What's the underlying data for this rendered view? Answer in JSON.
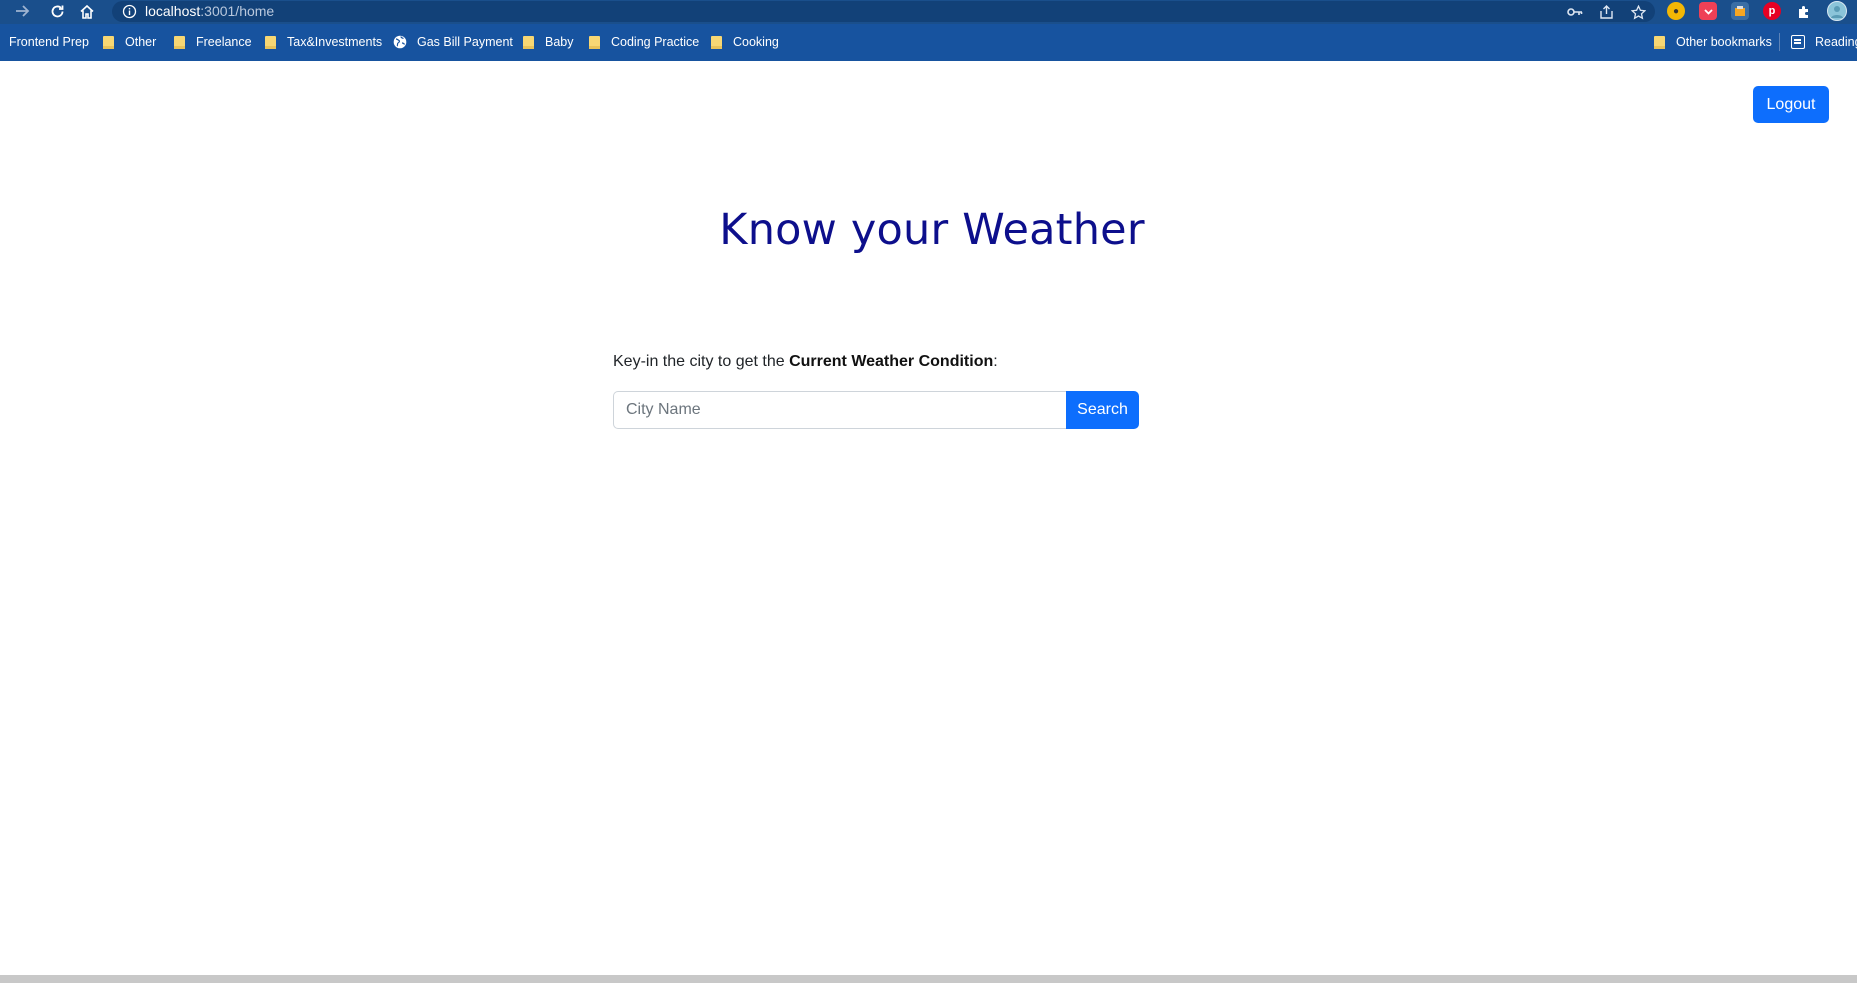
{
  "browser": {
    "url_host": "localhost",
    "url_path": ":3001/home",
    "extensions": [
      "key-icon",
      "share-icon",
      "star-icon",
      "honey-extension-icon",
      "pocket-extension-icon",
      "shop-extension-icon",
      "pinterest-extension-icon",
      "puzzle-icon",
      "profile-avatar"
    ]
  },
  "bookmarks": {
    "items": [
      {
        "label": "Frontend Prep",
        "icon": "none"
      },
      {
        "label": "Other",
        "icon": "folder-icon"
      },
      {
        "label": "Freelance",
        "icon": "folder-icon"
      },
      {
        "label": "Tax&Investments",
        "icon": "folder-icon"
      },
      {
        "label": "Gas Bill Payment",
        "icon": "globe-icon"
      },
      {
        "label": "Baby",
        "icon": "folder-icon"
      },
      {
        "label": "Coding Practice",
        "icon": "folder-icon"
      },
      {
        "label": "Cooking",
        "icon": "folder-icon"
      }
    ],
    "other_bookmarks": "Other bookmarks",
    "reading_list": "Reading"
  },
  "page": {
    "logout_label": "Logout",
    "title": "Know your Weather",
    "prompt_prefix": "Key-in the city to get the ",
    "prompt_bold": "Current Weather Condition",
    "prompt_suffix": ":",
    "search_placeholder": "City Name",
    "search_value": "",
    "search_label": "Search"
  },
  "colors": {
    "chrome_top": "#1a4f8c",
    "bookmarks_bar": "#17539f",
    "primary_button": "#0d6efd",
    "title_color": "#0d0f8c"
  }
}
